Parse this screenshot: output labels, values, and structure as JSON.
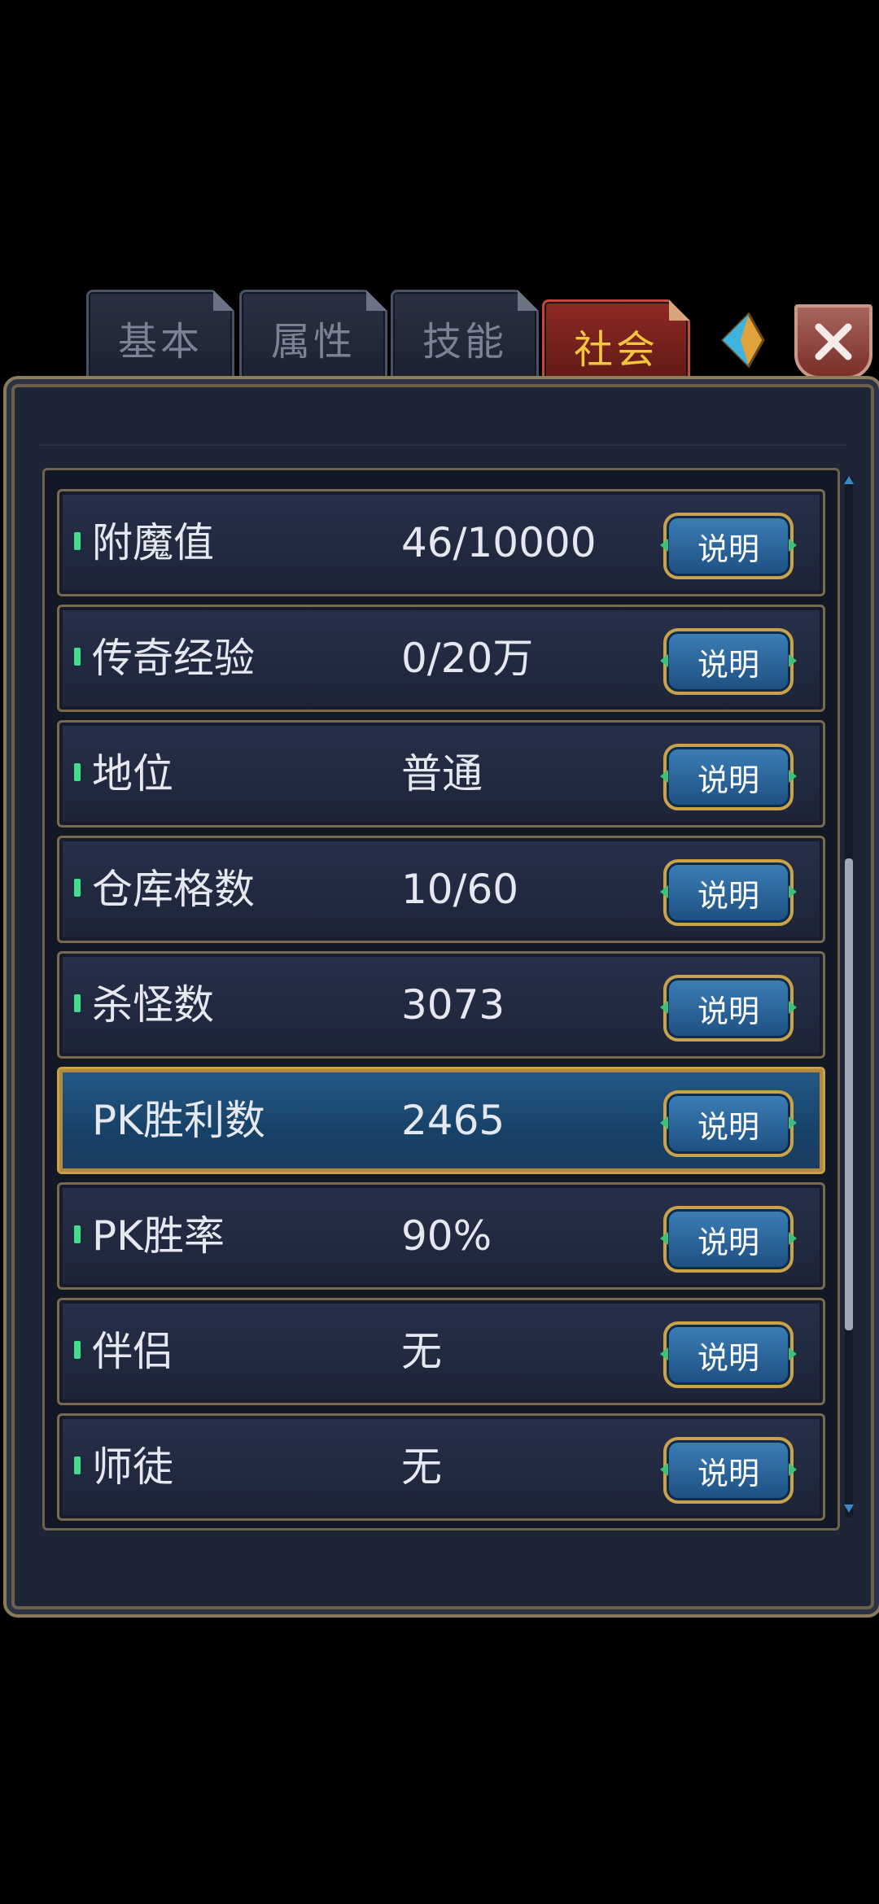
{
  "tabs": [
    {
      "label": "基本",
      "active": false
    },
    {
      "label": "属性",
      "active": false
    },
    {
      "label": "技能",
      "active": false
    },
    {
      "label": "社会",
      "active": true
    }
  ],
  "explain_label": "说明",
  "rows": [
    {
      "label": "附魔值",
      "value": "46/10000",
      "selected": false
    },
    {
      "label": "传奇经验",
      "value": "0/20万",
      "selected": false
    },
    {
      "label": "地位",
      "value": "普通",
      "selected": false
    },
    {
      "label": "仓库格数",
      "value": "10/60",
      "selected": false
    },
    {
      "label": "杀怪数",
      "value": "3073",
      "selected": false
    },
    {
      "label": "PK胜利数",
      "value": "2465",
      "selected": true
    },
    {
      "label": "PK胜率",
      "value": "90%",
      "selected": false
    },
    {
      "label": "伴侣",
      "value": "无",
      "selected": false
    },
    {
      "label": "师徒",
      "value": "无",
      "selected": false
    }
  ],
  "icons": {
    "next": "arrow-right-icon",
    "close": "close-icon"
  },
  "colors": {
    "active_tab_text": "#f2c63d",
    "selected_row": "#1b4a74",
    "button": "#2a64a0"
  }
}
